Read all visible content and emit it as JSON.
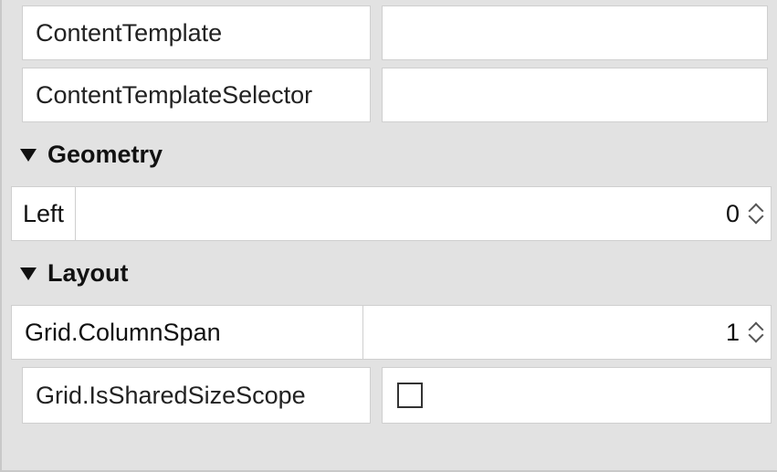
{
  "properties_top": [
    {
      "name": "ContentTemplate",
      "value": ""
    },
    {
      "name": "ContentTemplateSelector",
      "value": ""
    }
  ],
  "categories": {
    "geometry": {
      "title": "Geometry",
      "items": [
        {
          "name": "Left",
          "value": "0"
        }
      ]
    },
    "layout": {
      "title": "Layout",
      "items": [
        {
          "name": "Grid.ColumnSpan",
          "value": "1"
        },
        {
          "name": "Grid.IsSharedSizeScope",
          "checked": false
        }
      ]
    }
  }
}
